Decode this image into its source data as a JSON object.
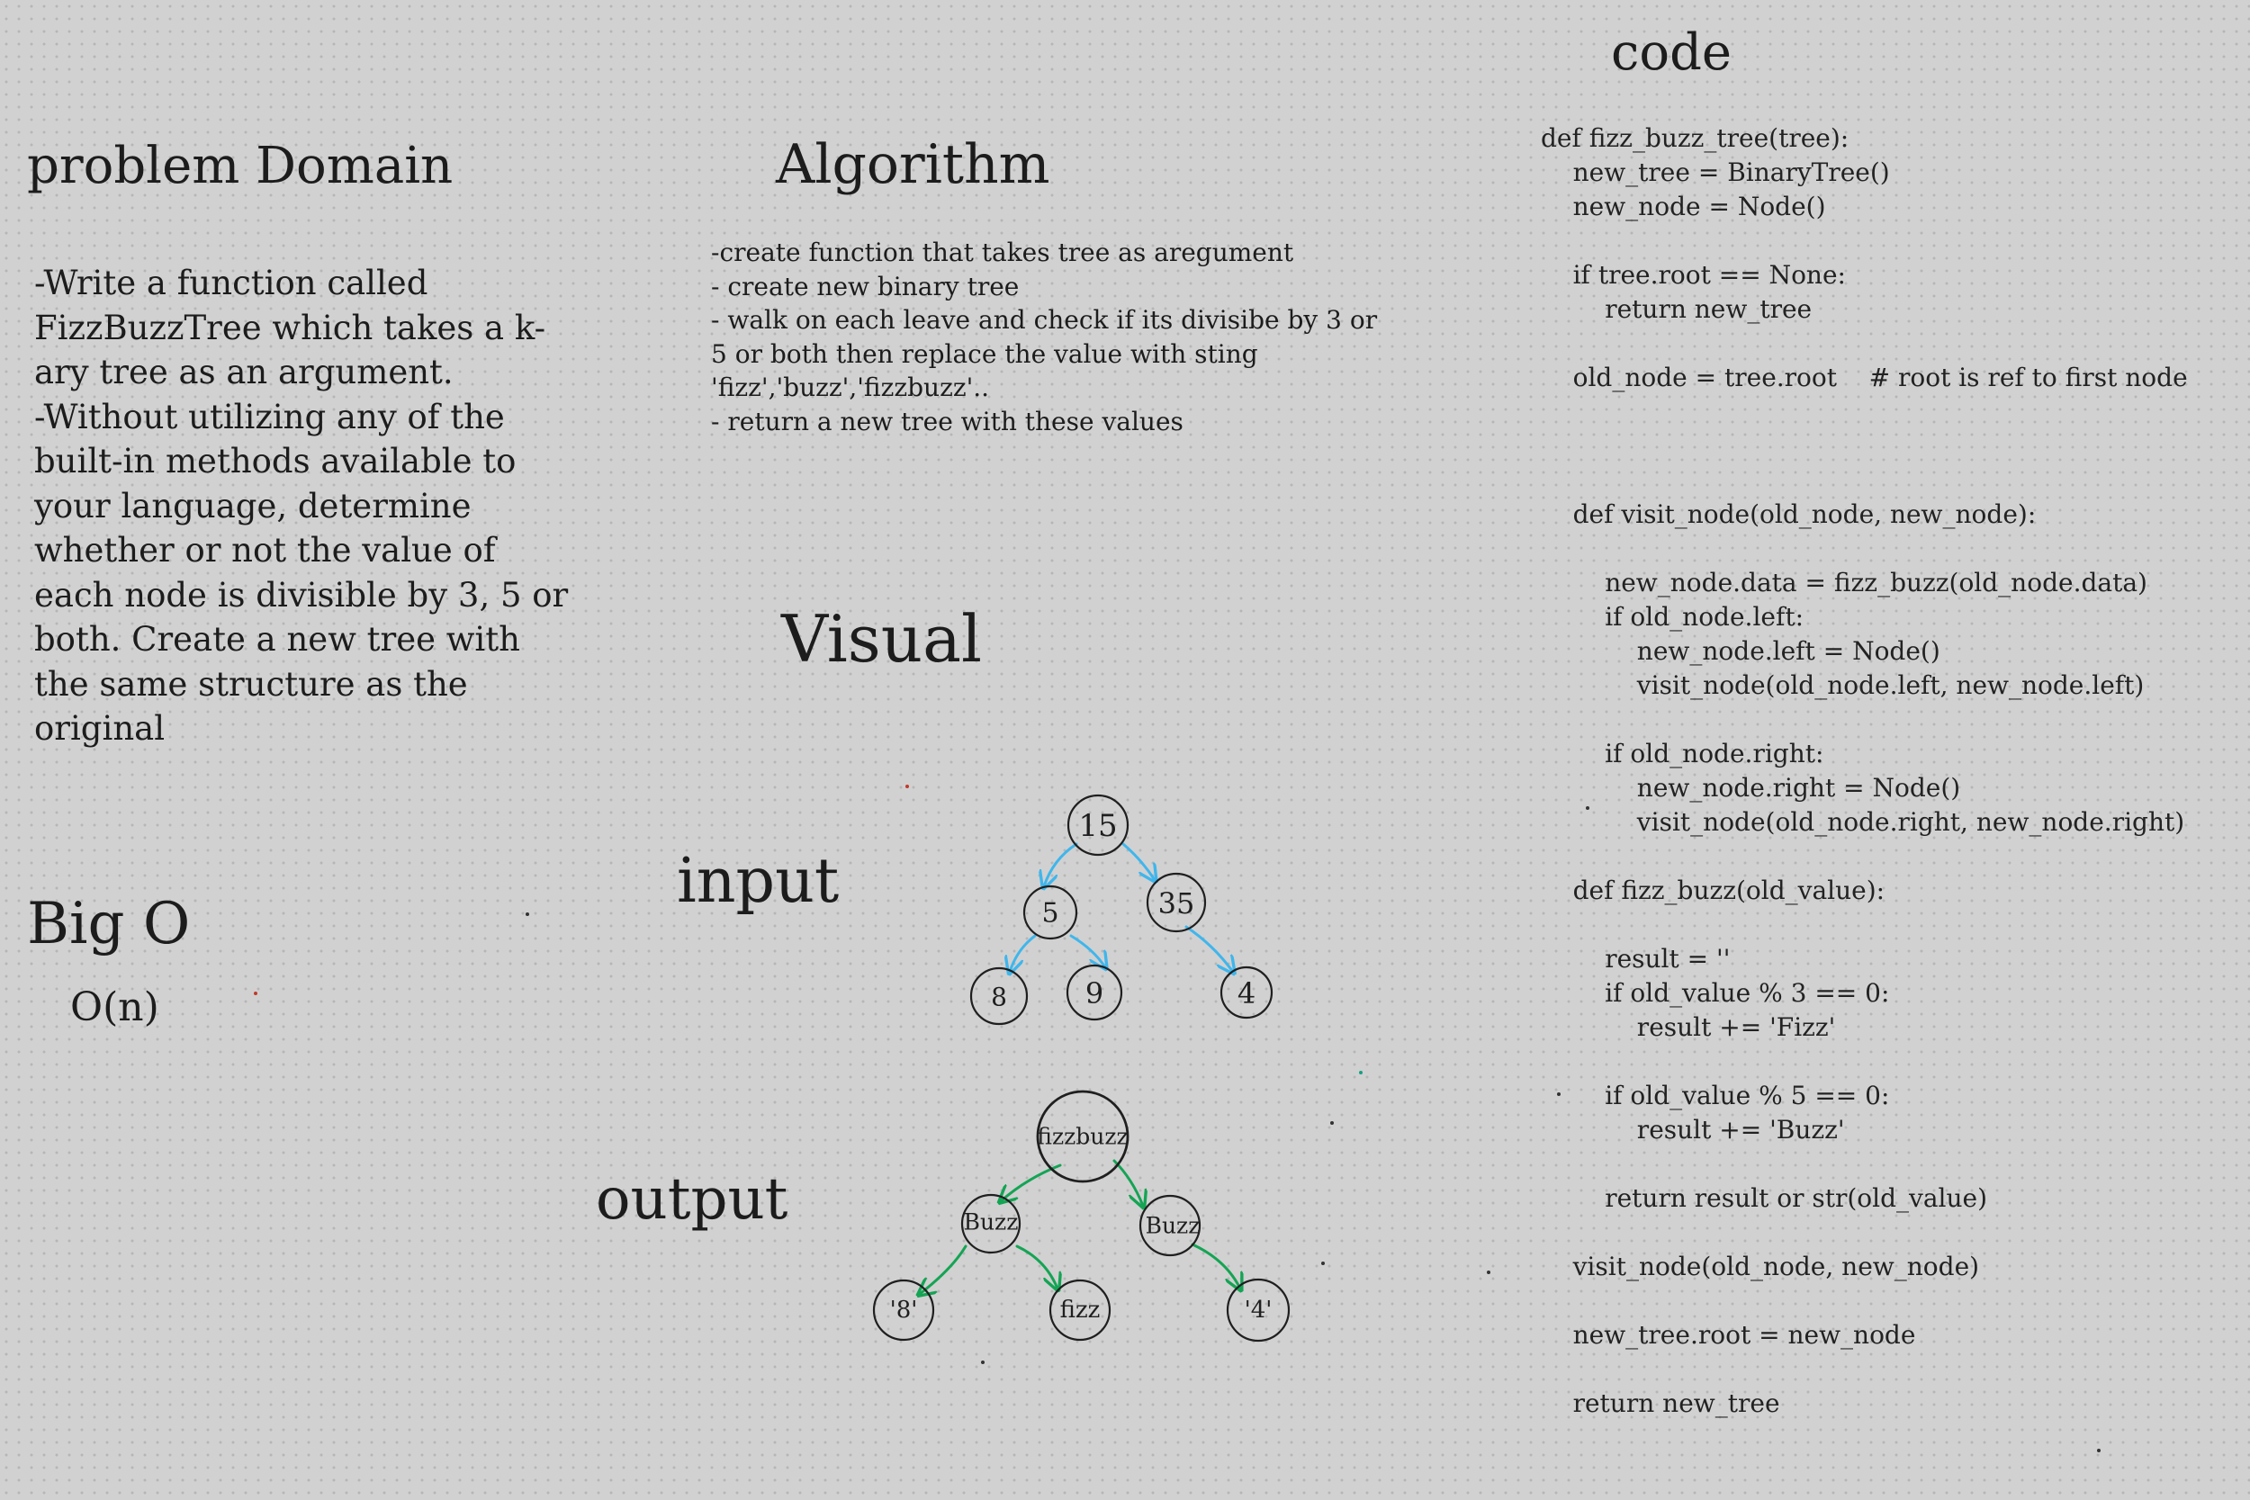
{
  "headings": {
    "problem": "problem Domain",
    "algorithm": "Algorithm",
    "code": "code",
    "visual": "Visual",
    "bigo": "Big O",
    "input": "input",
    "output": "output"
  },
  "problem_lines": [
    "-Write a function called",
    "FizzBuzzTree which takes a k-",
    "ary tree as an argument.",
    "-Without utilizing any of the",
    "built-in methods available to",
    "your language, determine",
    "whether or not the value of",
    "each node is divisible by 3, 5 or",
    "both. Create a new tree with",
    "the same structure as the",
    "original"
  ],
  "algorithm_lines": [
    "-create function that takes tree as aregument",
    "- create new binary tree",
    "- walk on each leave and check if its divisibe by 3 or",
    "5 or both then replace the value with sting",
    "'fizz','buzz','fizzbuzz'..",
    "- return a new tree with these values"
  ],
  "bigo_value": "O(n)",
  "code_lines": [
    "def fizz_buzz_tree(tree):",
    "    new_tree = BinaryTree()",
    "    new_node = Node()",
    "",
    "    if tree.root == None:",
    "        return new_tree",
    "",
    "    old_node = tree.root    # root is ref to first node",
    "",
    "",
    "",
    "    def visit_node(old_node, new_node):",
    "",
    "        new_node.data = fizz_buzz(old_node.data)",
    "        if old_node.left:",
    "            new_node.left = Node()",
    "            visit_node(old_node.left, new_node.left)",
    "",
    "        if old_node.right:",
    "            new_node.right = Node()",
    "            visit_node(old_node.right, new_node.right)",
    "",
    "    def fizz_buzz(old_value):",
    "",
    "        result = ''",
    "        if old_value % 3 == 0:",
    "            result += 'Fizz'",
    "",
    "        if old_value % 5 == 0:",
    "            result += 'Buzz'",
    "",
    "        return result or str(old_value)",
    "",
    "    visit_node(old_node, new_node)",
    "",
    "    new_tree.root = new_node",
    "",
    "    return new_tree"
  ],
  "input_tree": {
    "root": "15",
    "left": "5",
    "right": "35",
    "left_left": "8",
    "left_right": "9",
    "right_right": "4"
  },
  "output_tree": {
    "root": "fizzbuzz",
    "left": "Buzz",
    "right": "Buzz",
    "left_left": "'8'",
    "left_right": "fizz",
    "right_right": "'4'"
  },
  "colors": {
    "background": "#d1d1d1",
    "input_edges": "#3fb6ec",
    "output_edges": "#14a454",
    "ink": "#1c1c1c"
  }
}
